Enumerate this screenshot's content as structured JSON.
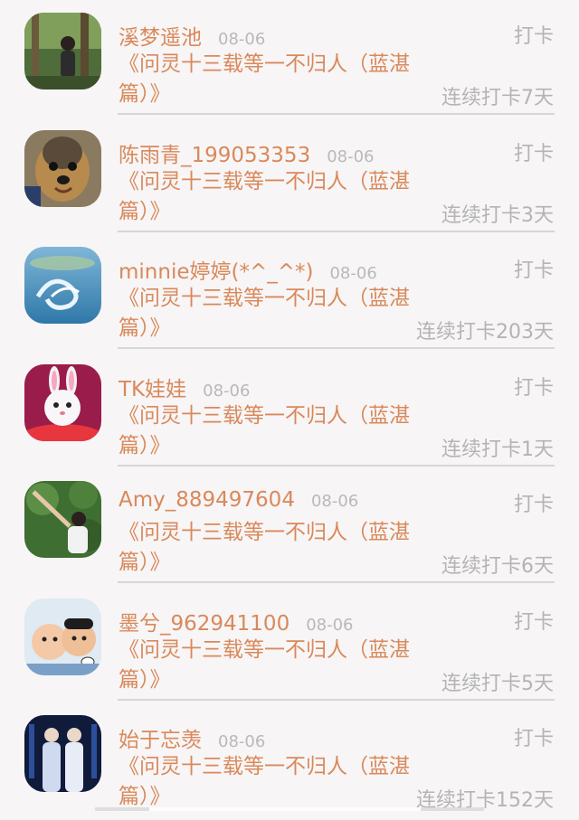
{
  "items": [
    {
      "name": "溪梦遥池",
      "date": "08-06",
      "action": "打卡",
      "title": "《问灵十三载等一不归人（蓝湛篇）》",
      "streak": "连续打卡7天",
      "avatar": "forest-person-avatar"
    },
    {
      "name": "陈雨青_199053353",
      "date": "08-06",
      "action": "打卡",
      "title": "《问灵十三载等一不归人（蓝湛篇）》",
      "streak": "连续打卡3天",
      "avatar": "dog-avatar"
    },
    {
      "name": "minnie婷婷(*^_^*)",
      "date": "08-06",
      "action": "打卡",
      "title": "《问灵十三载等一不归人（蓝湛篇）》",
      "streak": "连续打卡203天",
      "avatar": "water-swirl-avatar"
    },
    {
      "name": "TK娃娃",
      "date": "08-06",
      "action": "打卡",
      "title": "《问灵十三载等一不归人（蓝湛篇）》",
      "streak": "连续打卡1天",
      "avatar": "bunny-avatar"
    },
    {
      "name": "Amy_889497604",
      "date": "08-06",
      "action": "打卡",
      "title": "《问灵十三载等一不归人（蓝湛篇）》",
      "streak": "连续打卡6天",
      "avatar": "tree-person-avatar"
    },
    {
      "name": "墨兮_962941100",
      "date": "08-06",
      "action": "打卡",
      "title": "《问灵十三载等一不归人（蓝湛篇）》",
      "streak": "连续打卡5天",
      "avatar": "kids-avatar"
    },
    {
      "name": "始于忘羡",
      "date": "08-06",
      "action": "打卡",
      "title": "《问灵十三载等一不归人（蓝湛篇）》",
      "streak": "连续打卡152天",
      "avatar": "costume-avatar"
    }
  ]
}
